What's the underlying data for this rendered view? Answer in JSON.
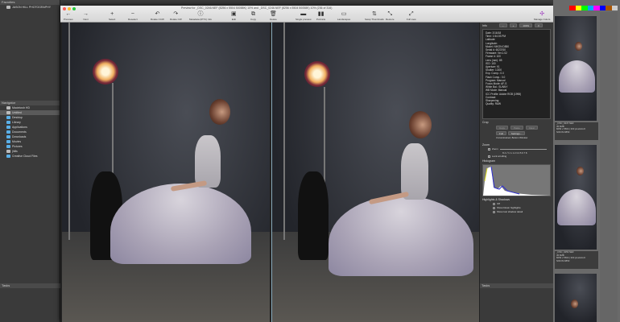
{
  "left_panel": {
    "favorites_label": "Favorites",
    "favorite_item": "JASON HILL PHOTOGRAPHY",
    "navigator_label": "Navigator",
    "nav_items": [
      "Macintosh HD",
      "Untitled",
      "Desktop",
      "Library",
      "Applications",
      "Documents",
      "Downloads",
      "Movies",
      "Pictures",
      "jhills",
      "Creative Cloud Files"
    ],
    "tasks_label": "Tasks"
  },
  "window": {
    "title": "Preview for _DSC_0246.NEF (8256 x 5504 50058K) 10% and _DSC_0246.NEF (8256 x 5504 50058K) 10% (236 of 316)",
    "toolbar": [
      {
        "icon": "←",
        "label": "Previous"
      },
      {
        "icon": "→",
        "label": "Next"
      },
      {
        "icon": "+",
        "label": "Select"
      },
      {
        "icon": "−",
        "label": "Deselect"
      },
      {
        "icon": "↶",
        "label": "Rotate CCW"
      },
      {
        "icon": "↷",
        "label": "Rotate CW"
      },
      {
        "icon": "ⓘ",
        "label": "Metadata (IPTC) Info"
      },
      {
        "icon": "▣",
        "label": "Edit"
      },
      {
        "icon": "⧉",
        "label": "Copy"
      },
      {
        "icon": "🗑",
        "label": "Delete"
      },
      {
        "icon": "▬",
        "label": "Single preview"
      },
      {
        "icon": "▮▮",
        "label": "Portraits"
      },
      {
        "icon": "▭",
        "label": "Landscapes"
      },
      {
        "icon": "⇅",
        "label": "Swap Thumbnails"
      },
      {
        "icon": "⤡",
        "label": "Restore"
      },
      {
        "icon": "⤢",
        "label": "Full view"
      }
    ],
    "manage_colors": "Manage Colors"
  },
  "info_panel": {
    "info_label": "Info",
    "zoom_value": "100%",
    "fields": [
      "Date: 2/16/18",
      "Time: 1:54:03 PM",
      "Latitude:",
      "Longitude:",
      "Model: NIKON D850",
      "Serial #: 6023760",
      "Firmware: Ver.1.02",
      "Frame #: 100",
      "Lens (mm): 85",
      "ISO: 100",
      "Aperture: f/1",
      "Shutter: 1/200",
      "Exp. Comp.: 0.0",
      "Flash Comp.: 0.0",
      "Program: Manual",
      "Focus Mode: AF-S",
      "White Bal.: SUNNY",
      "WB Mode: Manual",
      "ICC Profile: Adobe RGB (1998)",
      "Contrast:",
      "Sharpening:",
      "Quality: RAW"
    ],
    "crop_label": "Crop",
    "crop_buttons": [
      "Copy",
      "Paste",
      "Clear"
    ],
    "full_label": "Full",
    "settings_label": "Settings...",
    "crop_note": "Unconstrained, Bottom Window",
    "zoom_label": "Zoom",
    "zoom_check": "Zoom",
    "zoom_ticks": "% ¼ ½ ¾ 1 2 3 4 5 6 7 8",
    "lock_scrolling": "Lock scrolling",
    "histogram_label": "Histogram",
    "hs_label": "Highlights & Shadows",
    "hs_options": [
      "Off",
      "Show blown highlights",
      "Show lost shadow detail"
    ],
    "tasks_label": "Tasks"
  },
  "contact_sheet": {
    "thumbs": [
      {
        "name": "_DSC_0247.NEF",
        "size": "45.6MB",
        "dims": "8256 x 5504 | 300 pixels/inch",
        "camera": "NIKON D850"
      },
      {
        "name": "_DSC_0253.NEF",
        "size": "45.6MB",
        "dims": "8256 x 5504 | 300 pixels/inch",
        "camera": "NIKON D850"
      }
    ]
  },
  "colors": {
    "accent": "#5ab0e8",
    "toolbar": "#e0e0e0",
    "panel": "#3a3a3a"
  }
}
